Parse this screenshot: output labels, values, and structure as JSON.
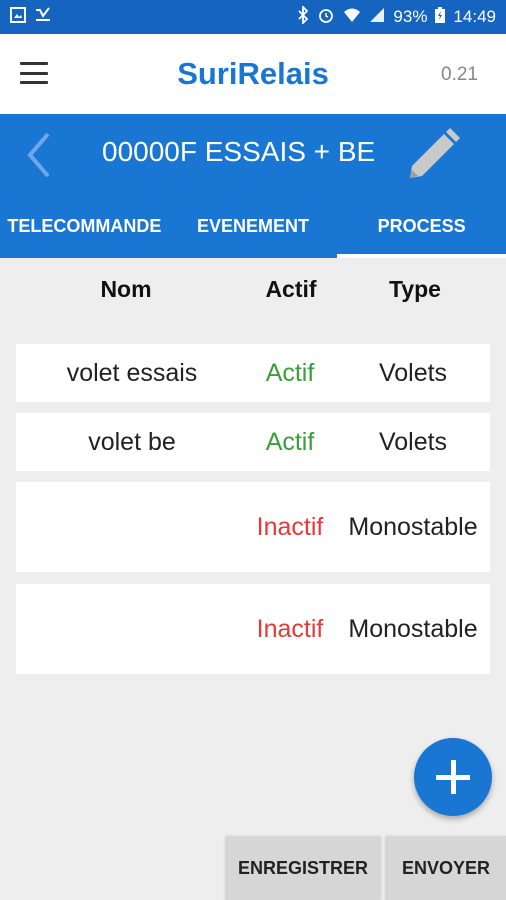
{
  "status_bar": {
    "battery": "93%",
    "time": "14:49"
  },
  "app": {
    "title": "SuriRelais",
    "version": "0.21"
  },
  "device": {
    "title": "00000F ESSAIS + BE"
  },
  "tabs": [
    {
      "label": "TELECOMMANDE",
      "active": false
    },
    {
      "label": "EVENEMENT",
      "active": false
    },
    {
      "label": "PROCESS",
      "active": true
    }
  ],
  "table": {
    "headers": {
      "nom": "Nom",
      "actif": "Actif",
      "type": "Type"
    },
    "rows": [
      {
        "nom": "volet essais",
        "actif": "Actif",
        "type": "Volets"
      },
      {
        "nom": "volet be",
        "actif": "Actif",
        "type": "Volets"
      },
      {
        "nom": "",
        "actif": "Inactif",
        "type": "Monostable"
      },
      {
        "nom": "",
        "actif": "Inactif",
        "type": "Monostable"
      }
    ]
  },
  "buttons": {
    "save": "ENREGISTRER",
    "send": "ENVOYER"
  },
  "colors": {
    "primary": "#1976d2",
    "status_bar": "#1565c0",
    "active_text": "#3a9e3a",
    "inactive_text": "#e53935"
  }
}
